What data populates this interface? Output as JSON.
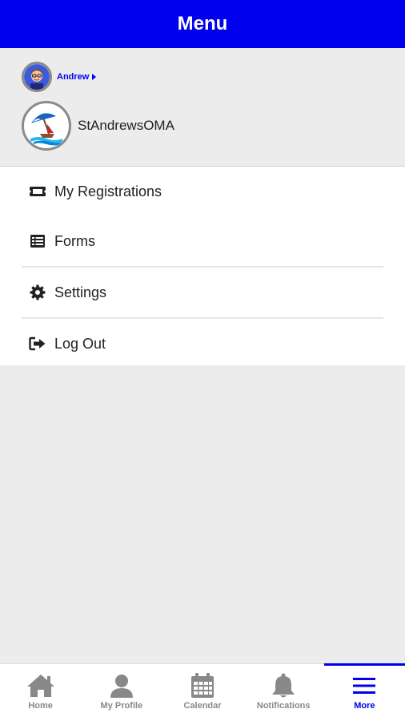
{
  "header": {
    "title": "Menu"
  },
  "user": {
    "name": "Andrew"
  },
  "organization": {
    "name": "StAndrewsOMA"
  },
  "menu": {
    "items": [
      {
        "label": "My Registrations",
        "icon": "ticket-icon"
      },
      {
        "label": "Forms",
        "icon": "list-icon"
      },
      {
        "label": "Settings",
        "icon": "gear-icon"
      },
      {
        "label": "Log Out",
        "icon": "sign-out-icon"
      }
    ]
  },
  "tabbar": {
    "tabs": [
      {
        "label": "Home",
        "icon": "home-icon",
        "active": false
      },
      {
        "label": "My Profile",
        "icon": "user-icon",
        "active": false
      },
      {
        "label": "Calendar",
        "icon": "calendar-icon",
        "active": false
      },
      {
        "label": "Notifications",
        "icon": "bell-icon",
        "active": false
      },
      {
        "label": "More",
        "icon": "hamburger-menu-icon",
        "active": true
      }
    ]
  },
  "colors": {
    "accent": "#0000ee",
    "background": "#ececec",
    "inactive_tab": "#888888"
  }
}
